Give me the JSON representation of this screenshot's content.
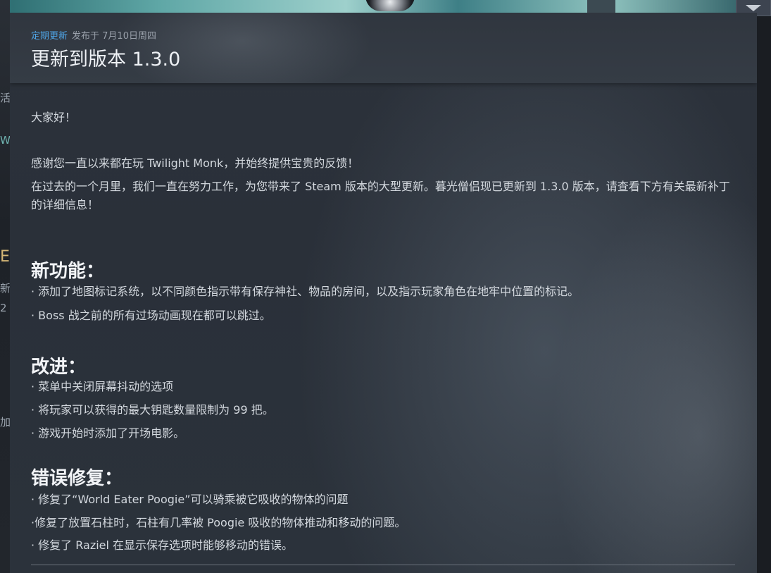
{
  "event": {
    "tag": "定期更新",
    "published": "发布于 7月10日周四",
    "title": "更新到版本 1.3.0"
  },
  "content": {
    "greeting": "大家好！",
    "para1": "感谢您一直以来都在玩 Twilight Monk，并始终提供宝贵的反馈！",
    "para2": "在过去的一个月里，我们一直在努力工作，为您带来了 Steam 版本的大型更新。暮光僧侣现已更新到 1.3.0 版本，请查看下方有关最新补丁的详细信息！",
    "sections": [
      {
        "heading": "新功能：",
        "items": [
          " · 添加了地图标记系统，以不同颜色指示带有保存神社、物品的房间，以及指示玩家角色在地牢中位置的标记。",
          " · Boss 战之前的所有过场动画现在都可以跳过。"
        ]
      },
      {
        "heading": "改进：",
        "items": [
          " · 菜单中关闭屏幕抖动的选项",
          " · 将玩家可以获得的最大钥匙数量限制为 99 把。",
          " · 游戏开始时添加了开场电影。"
        ]
      },
      {
        "heading": "错误修复：",
        "items": [
          " · 修复了“World Eater Poogie”可以骑乘被它吸收的物体的问题",
          "·修复了放置石柱时，石柱有几率被 Poogie 吸收的物体推动和移动的问题。",
          " · 修复了 Raziel 在显示保存选项时能够移动的错误。"
        ]
      }
    ]
  },
  "background_fragments": [
    "活",
    "W",
    "E",
    "新",
    "2",
    "加"
  ],
  "colors": {
    "accent": "#4fa6e8",
    "text": "#d3d8de",
    "heading": "#f2f4f7",
    "modal_bg": "#2c323b"
  },
  "icons": {
    "dropdown": "chevron-down-icon"
  }
}
